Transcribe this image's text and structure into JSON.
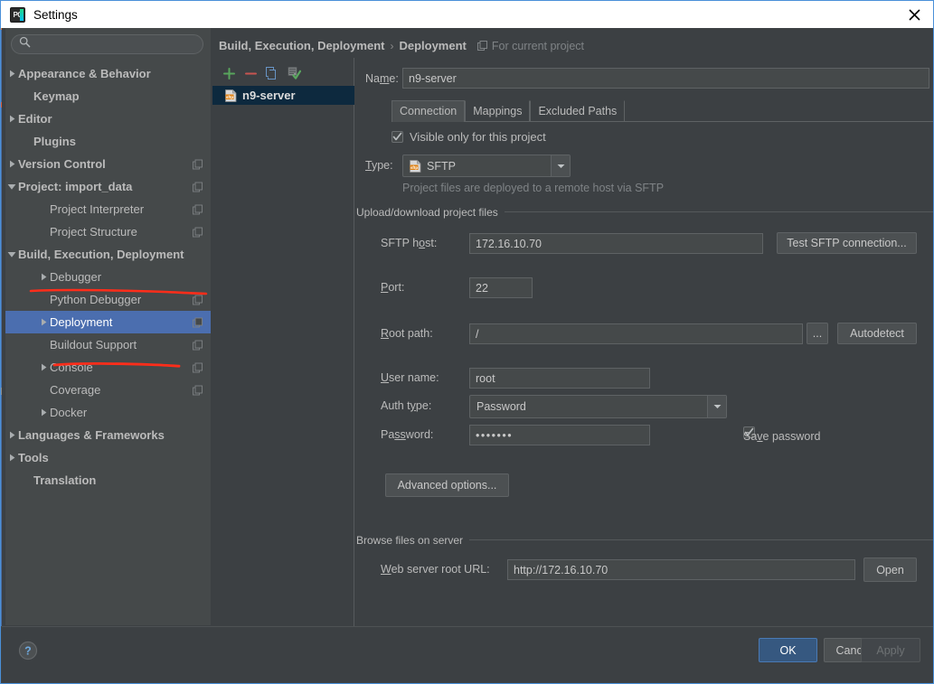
{
  "window": {
    "title": "Settings",
    "app_icon": "pycharm-icon",
    "close_icon": "close-icon"
  },
  "sidebar": {
    "search": {
      "placeholder": "",
      "value": "",
      "icon": "search-icon"
    },
    "items": [
      {
        "label": "Appearance & Behavior",
        "indent": 14,
        "arrow": "right",
        "bold": true,
        "badge": false,
        "selected": false
      },
      {
        "label": "Keymap",
        "indent": 31,
        "arrow": "none",
        "bold": true,
        "badge": false,
        "selected": false
      },
      {
        "label": "Editor",
        "indent": 14,
        "arrow": "right",
        "bold": true,
        "badge": false,
        "selected": false
      },
      {
        "label": "Plugins",
        "indent": 31,
        "arrow": "none",
        "bold": true,
        "badge": false,
        "selected": false
      },
      {
        "label": "Version Control",
        "indent": 14,
        "arrow": "right",
        "bold": true,
        "badge": true,
        "selected": false
      },
      {
        "label": "Project: import_data",
        "indent": 14,
        "arrow": "down",
        "bold": true,
        "badge": true,
        "selected": false
      },
      {
        "label": "Project Interpreter",
        "indent": 49,
        "arrow": "none",
        "bold": false,
        "badge": true,
        "selected": false
      },
      {
        "label": "Project Structure",
        "indent": 49,
        "arrow": "none",
        "bold": false,
        "badge": true,
        "selected": false
      },
      {
        "label": "Build, Execution, Deployment",
        "indent": 14,
        "arrow": "down",
        "bold": true,
        "badge": false,
        "selected": false
      },
      {
        "label": "Debugger",
        "indent": 49,
        "arrow": "right",
        "bold": false,
        "badge": false,
        "selected": false
      },
      {
        "label": "Python Debugger",
        "indent": 49,
        "arrow": "none",
        "bold": false,
        "badge": true,
        "selected": false
      },
      {
        "label": "Deployment",
        "indent": 49,
        "arrow": "right",
        "bold": false,
        "badge": true,
        "selected": true
      },
      {
        "label": "Buildout Support",
        "indent": 49,
        "arrow": "none",
        "bold": false,
        "badge": true,
        "selected": false
      },
      {
        "label": "Console",
        "indent": 49,
        "arrow": "right",
        "bold": false,
        "badge": true,
        "selected": false
      },
      {
        "label": "Coverage",
        "indent": 49,
        "arrow": "none",
        "bold": false,
        "badge": true,
        "selected": false
      },
      {
        "label": "Docker",
        "indent": 49,
        "arrow": "right",
        "bold": false,
        "badge": false,
        "selected": false
      },
      {
        "label": "Languages & Frameworks",
        "indent": 14,
        "arrow": "right",
        "bold": true,
        "badge": false,
        "selected": false
      },
      {
        "label": "Tools",
        "indent": 14,
        "arrow": "right",
        "bold": true,
        "badge": false,
        "selected": false
      },
      {
        "label": "Translation",
        "indent": 31,
        "arrow": "none",
        "bold": true,
        "badge": false,
        "selected": false
      }
    ],
    "annotations": [
      {
        "name": "underline-build-execution-deployment",
        "color": "#ff2d1a"
      },
      {
        "name": "underline-deployment",
        "color": "#ff2d1a"
      }
    ]
  },
  "breadcrumb": {
    "root": "Build, Execution, Deployment",
    "separator": "›",
    "leaf": "Deployment",
    "scope_icon": "project-scope-icon",
    "scope": "For current project"
  },
  "server_pane": {
    "toolbar": [
      {
        "name": "add-server-button",
        "icon": "plus-icon"
      },
      {
        "name": "remove-server-button",
        "icon": "minus-icon"
      },
      {
        "name": "copy-server-button",
        "icon": "copy-icon"
      },
      {
        "name": "set-default-button",
        "icon": "set-default-icon"
      }
    ],
    "servers": [
      {
        "label": "n9-server",
        "icon": "sftp-icon",
        "selected": true
      }
    ]
  },
  "form": {
    "name_label": "Na<u>m</u>e:",
    "name_value": "n9-server",
    "tabs": [
      {
        "label": "Connection",
        "active": true
      },
      {
        "label": "Mappings",
        "active": false
      },
      {
        "label": "Excluded Paths",
        "active": false
      }
    ],
    "visible_only": {
      "label": "Visible only for this project",
      "checked": true
    },
    "type_label": "<u>T</u>ype:",
    "type_value": "SFTP",
    "type_icon": "sftp-icon",
    "type_hint": "Project files are deployed to a remote host via SFTP",
    "upload_group": {
      "title": "Upload/download project files",
      "sftp_host_label": "SFTP h<u>o</u>st:",
      "sftp_host_value": "172.16.10.70",
      "test_button": "Test SFTP connection...",
      "port_label": "<u>P</u>ort:",
      "port_value": "22",
      "root_path_label": "<u>R</u>oot path:",
      "root_path_value": "/",
      "browse_button": "...",
      "autodetect_button": "Autodetect",
      "user_name_label": "<u>U</u>ser name:",
      "user_name_value": "root",
      "auth_type_label": "Auth t<u>y</u>pe:",
      "auth_type_value": "Password",
      "password_label": "Pa<u>ss</u>word:",
      "password_value": "•••••••",
      "save_password": {
        "label": "Sa<u>v</u>e password",
        "checked": true
      },
      "advanced_button": "Advanced options..."
    },
    "browse_group": {
      "title": "Browse files on server",
      "web_url_label": "<u>W</u>eb server root URL:",
      "web_url_value": "http://172.16.10.70",
      "open_button": "Open"
    }
  },
  "footer": {
    "help_icon": "help-icon",
    "ok": "OK",
    "cancel": "Cancel",
    "apply": "Apply"
  },
  "colors": {
    "window_bg": "#3c4043",
    "sidebar_bg": "#45494a",
    "selection_blue": "#4b6eaf",
    "list_selection": "#0d293e",
    "accent_border": "#4a90d9",
    "ok_button": "#365880",
    "annotation_red": "#ff2d1a",
    "text": "#bbbbbb",
    "muted_text": "#7f8386"
  }
}
